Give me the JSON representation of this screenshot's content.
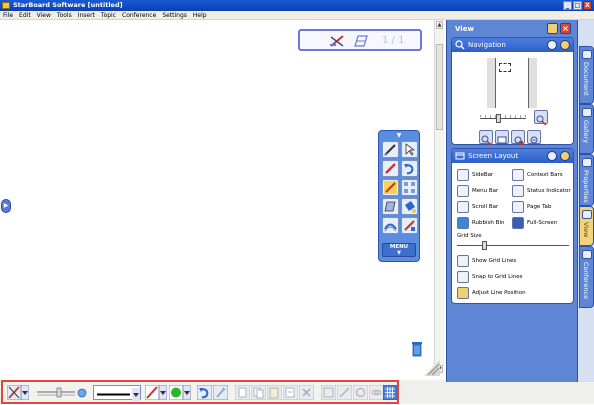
{
  "window": {
    "title": "StarBoard Software [untitled]",
    "controls": [
      "_",
      "□",
      "X"
    ]
  },
  "menubar": {
    "items": [
      "File",
      "Edit",
      "View",
      "Tools",
      "Insert",
      "Topic",
      "Conference",
      "Settings",
      "Help"
    ]
  },
  "page_tab": {
    "counter": "1 / 1"
  },
  "palette": {
    "menu_label": "MENU"
  },
  "right_panel": {
    "title": "View",
    "navigation": {
      "title": "Navigation"
    },
    "screen_layout": {
      "title": "Screen Layout",
      "options": [
        {
          "label": "SideBar",
          "icon": "sidebar-icon"
        },
        {
          "label": "Context Bars",
          "icon": "context-bars-icon"
        },
        {
          "label": "Menu Bar",
          "icon": "menu-bar-icon"
        },
        {
          "label": "Status Indicator",
          "icon": "status-indicator-icon"
        },
        {
          "label": "Scroll Bar",
          "icon": "scroll-bar-icon"
        },
        {
          "label": "Page Tab",
          "icon": "page-tab-icon"
        },
        {
          "label": "Rubbish Bin",
          "icon": "rubbish-bin-icon"
        },
        {
          "label": "Full-Screen",
          "icon": "full-screen-icon"
        }
      ],
      "grid_size_label": "Grid Size",
      "grid_options": [
        {
          "label": "Show Grid Lines"
        },
        {
          "label": "Snap to Grid Lines"
        },
        {
          "label": "Adjust Line Position"
        }
      ]
    }
  },
  "side_tabs": [
    {
      "label": "Document",
      "active": false
    },
    {
      "label": "Gallery",
      "active": false
    },
    {
      "label": "Properties",
      "active": false
    },
    {
      "label": "View",
      "active": true
    },
    {
      "label": "Conference",
      "active": false
    }
  ],
  "colors": {
    "accent_blue": "#5f86d5",
    "toolbar_highlight": "#e0473a",
    "active_tab": "#f3d27a",
    "green_color_swatch": "#2bb52b"
  }
}
